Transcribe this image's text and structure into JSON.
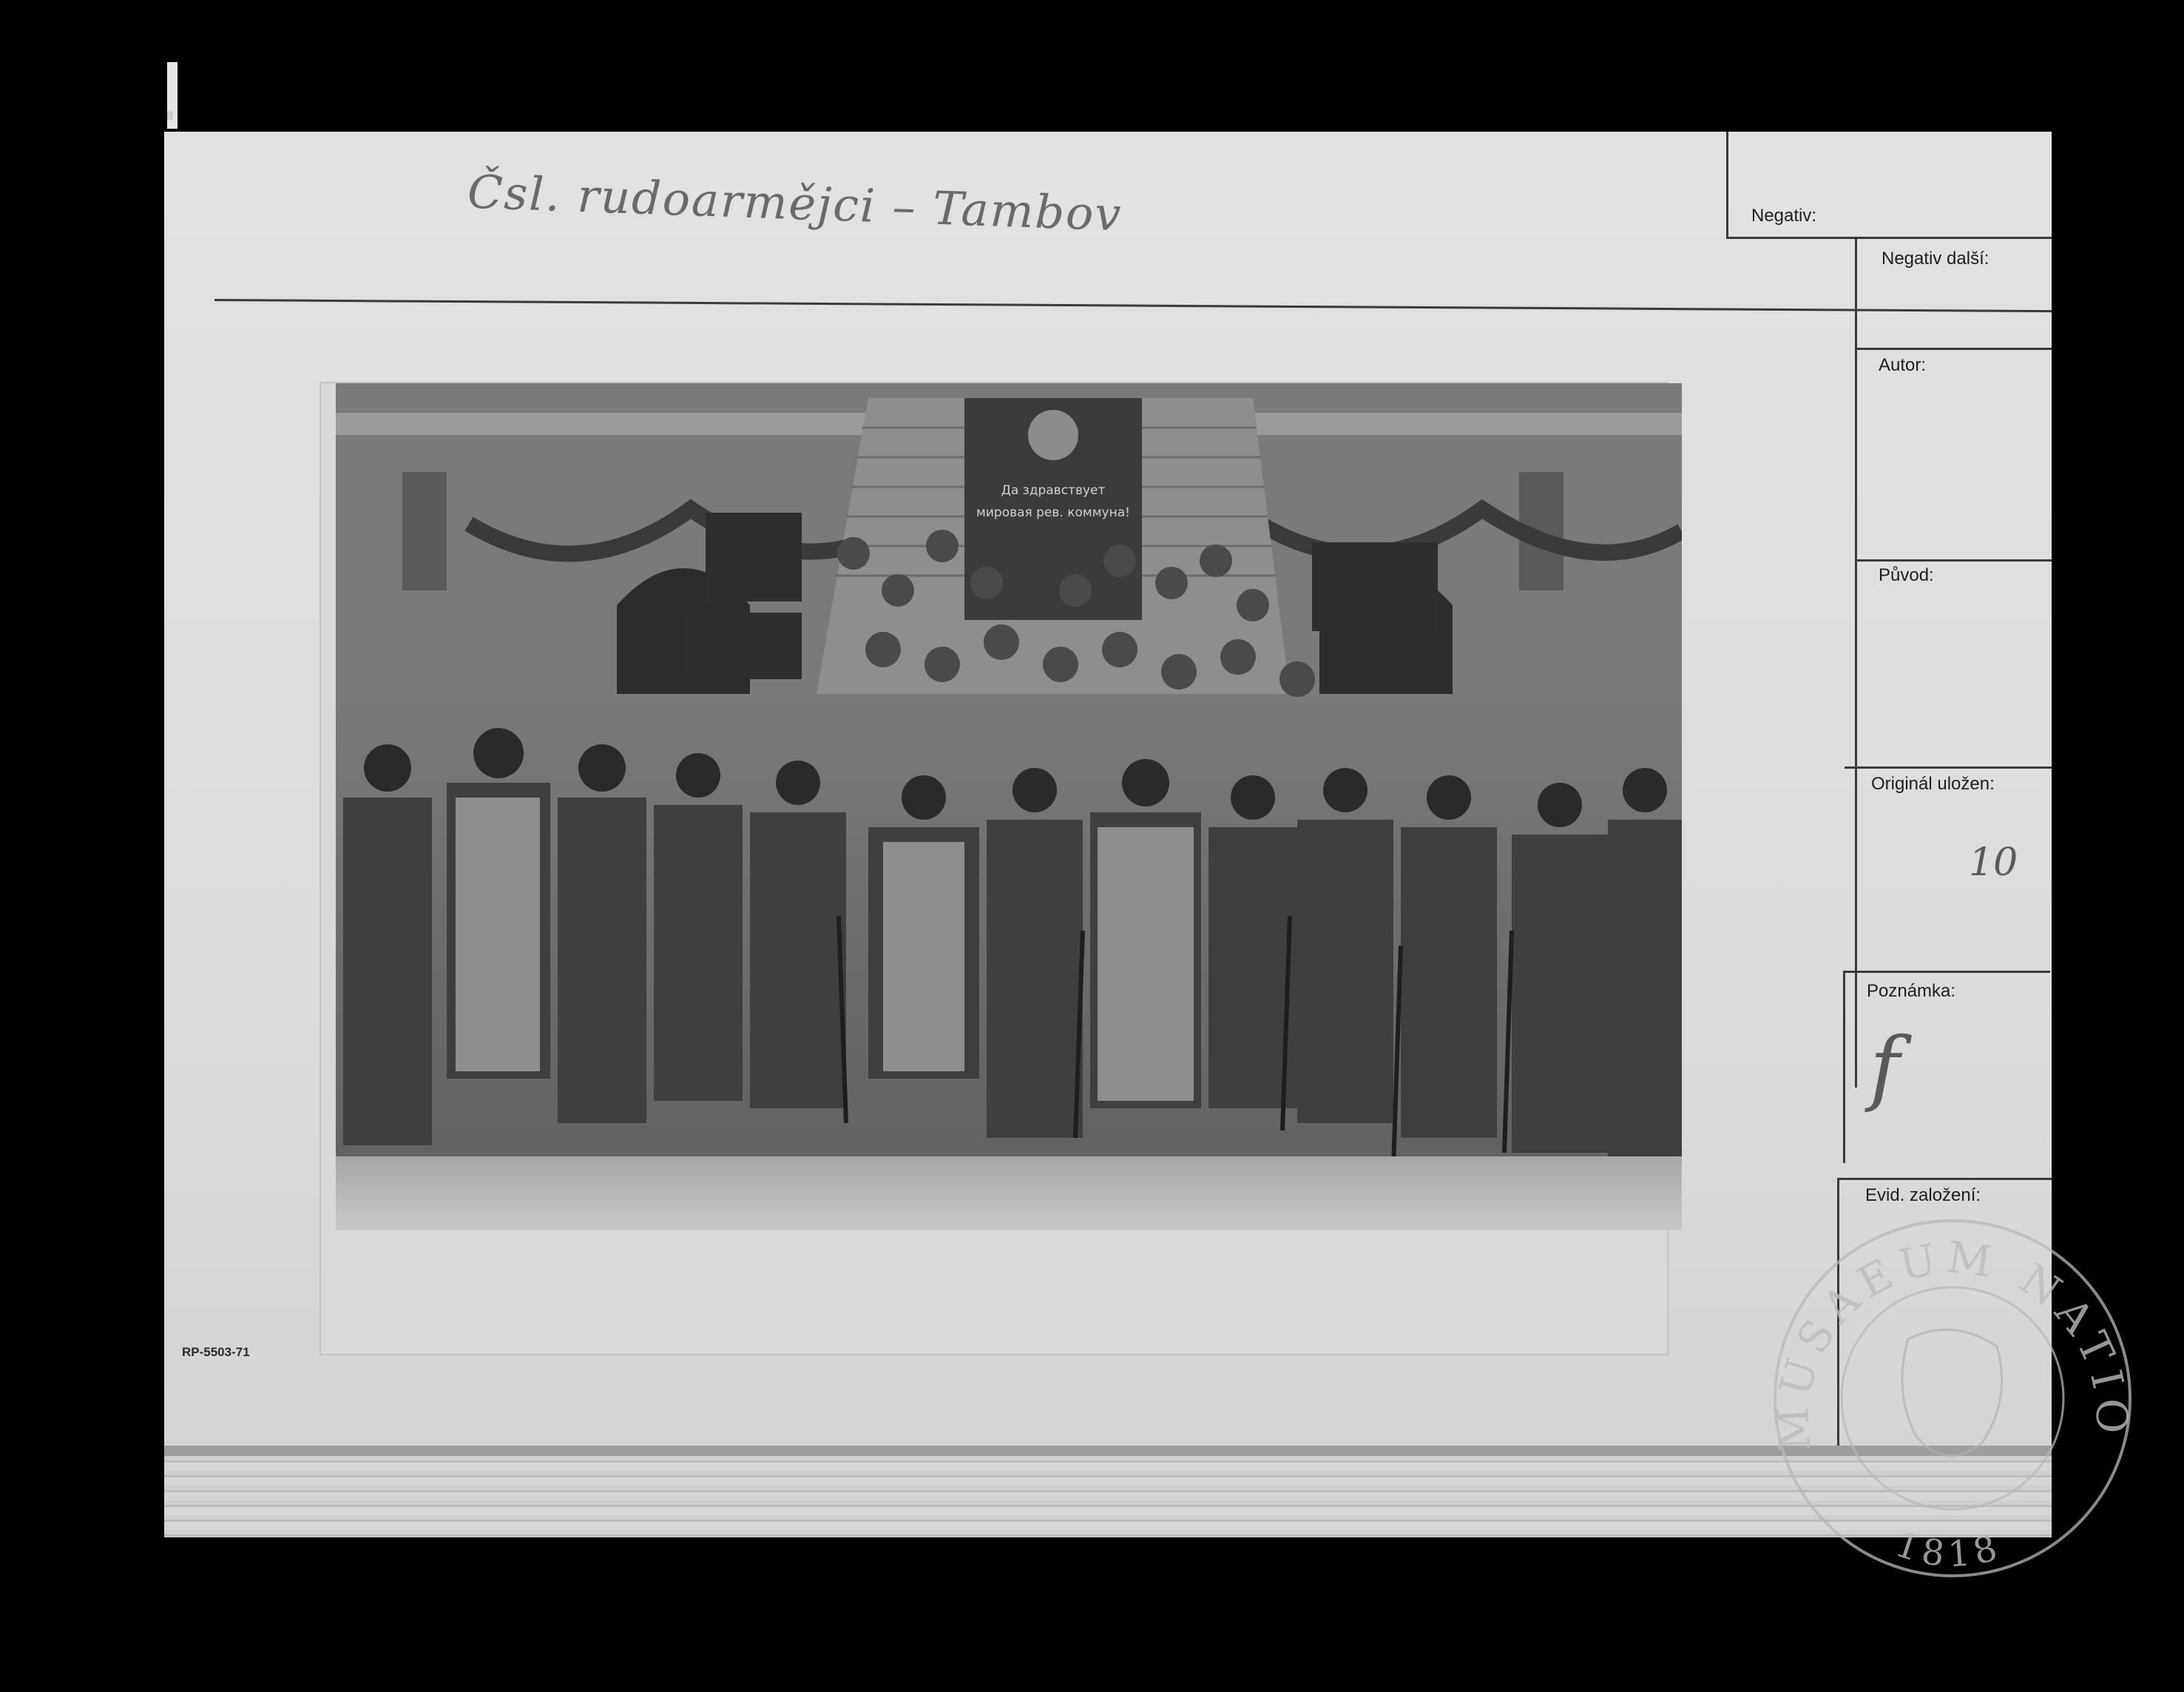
{
  "card": {
    "handwritten_title": "Čsl. rudoarmějci – Tambov",
    "catalog_number": "RP-5503-71"
  },
  "fields": [
    {
      "label": "Negativ:",
      "value": ""
    },
    {
      "label": "Negativ další:",
      "value": ""
    },
    {
      "label": "Autor:",
      "value": ""
    },
    {
      "label": "Původ:",
      "value": ""
    },
    {
      "label": "Originál uložen:",
      "value": "10"
    },
    {
      "label": "Poznámka:",
      "value": "f"
    },
    {
      "label": "Evid. založení:",
      "value": ""
    }
  ],
  "photo": {
    "banner_center": "Да здравствует мировая рев. коммуна!",
    "banner_left": "",
    "banner_right": ""
  },
  "stamp": {
    "text": "MUSAEUM NATIONALE",
    "year": "1818"
  }
}
